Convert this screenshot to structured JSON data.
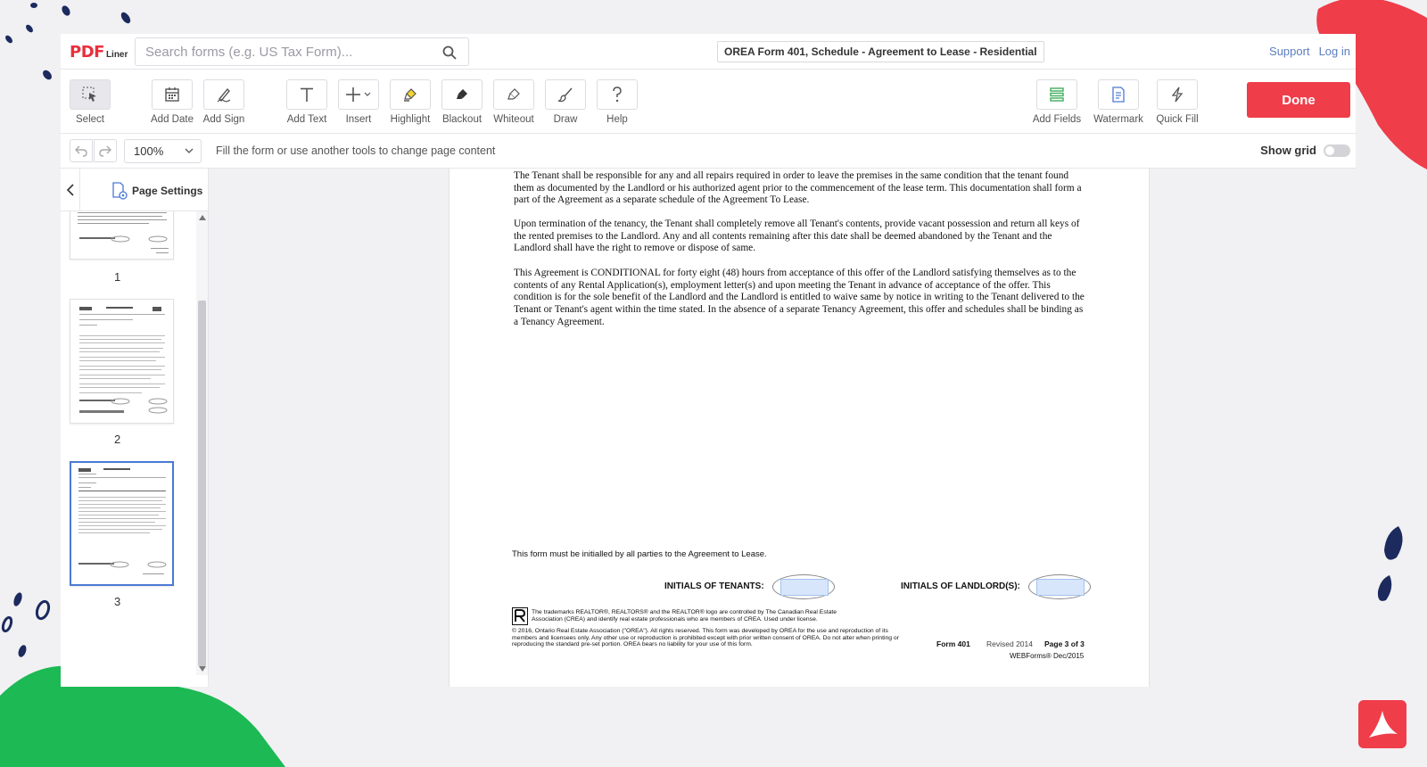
{
  "app": {
    "logo_main": "PDF",
    "logo_sub": "Liner"
  },
  "search": {
    "placeholder": "Search forms (e.g. US Tax Form)..."
  },
  "document_title": "OREA Form 401, Schedule - Agreement to Lease - Residential",
  "top_links": {
    "support": "Support",
    "login": "Log in"
  },
  "toolbar": {
    "select": "Select",
    "add_date": "Add Date",
    "add_sign": "Add Sign",
    "add_text": "Add Text",
    "insert": "Insert",
    "highlight": "Highlight",
    "blackout": "Blackout",
    "whiteout": "Whiteout",
    "draw": "Draw",
    "help": "Help",
    "add_fields": "Add Fields",
    "watermark": "Watermark",
    "quick_fill": "Quick Fill",
    "done": "Done"
  },
  "subbar": {
    "zoom": "100%",
    "hint": "Fill the form or use another tools to change page content",
    "show_grid": "Show grid",
    "show_grid_on": false
  },
  "sidebar": {
    "page_settings": "Page Settings",
    "pages": [
      "1",
      "2",
      "3"
    ],
    "selected_page": "3"
  },
  "document": {
    "para1": "The Tenant shall be responsible for any and all repairs required in order to leave the premises in the same condition that the tenant found them as documented by the Landlord or his authorized agent prior to the commencement of the lease term. This documentation shall form a part of the Agreement as a separate schedule of the Agreement To Lease.",
    "para2": "Upon termination of the tenancy, the Tenant shall completely remove all Tenant's contents, provide vacant possession and return all keys of the rented premises to the Landlord.  Any and all contents remaining after this date shall be deemed abandoned by the Tenant and the Landlord shall have the right to remove or dispose of same.",
    "para3": "This Agreement is CONDITIONAL for forty eight (48) hours from acceptance of this offer of the Landlord satisfying themselves as to the contents of any Rental Application(s), employment letter(s) and upon meeting the Tenant in advance of acceptance of the offer. This condition is for the sole benefit of the Landlord  and the Landlord is entitled to waive same by notice in writing to the Tenant delivered to the Tenant or Tenant's agent within the time stated.  In the absence of a separate Tenancy Agreement, this offer and schedules shall be binding as a Tenancy Agreement.",
    "initial_note": "This form must be initialled by all parties to the Agreement to Lease.",
    "initials_tenants": "INITIALS OF TENANTS:",
    "initials_landlords": "INITIALS OF LANDLORD(S):",
    "trademark": "The trademarks REALTOR®, REALTORS® and the REALTOR® logo are controlled by The Canadian Real Estate Association (CREA) and identify real estate professionals who are members of CREA. Used under license.",
    "copyright": "© 2016, Ontario Real Estate Association (\"OREA\"). All rights reserved. This form was developed by OREA for the use and reproduction of its members and licensees only. Any other use or reproduction is prohibited except with prior written consent of OREA. Do not alter when printing or reproducing the standard pre-set portion. OREA bears no liability for your use of this form.",
    "form_number": "Form 401",
    "revised": "Revised 2014",
    "page_of": "Page 3 of 3",
    "webforms": "WEBForms® Dec/2015"
  },
  "colors": {
    "accent": "#ef3d4a",
    "link": "#5c7dbf",
    "selected": "#4a79d4",
    "green_decor": "#1db954",
    "navy_decor": "#1c2a5e"
  }
}
